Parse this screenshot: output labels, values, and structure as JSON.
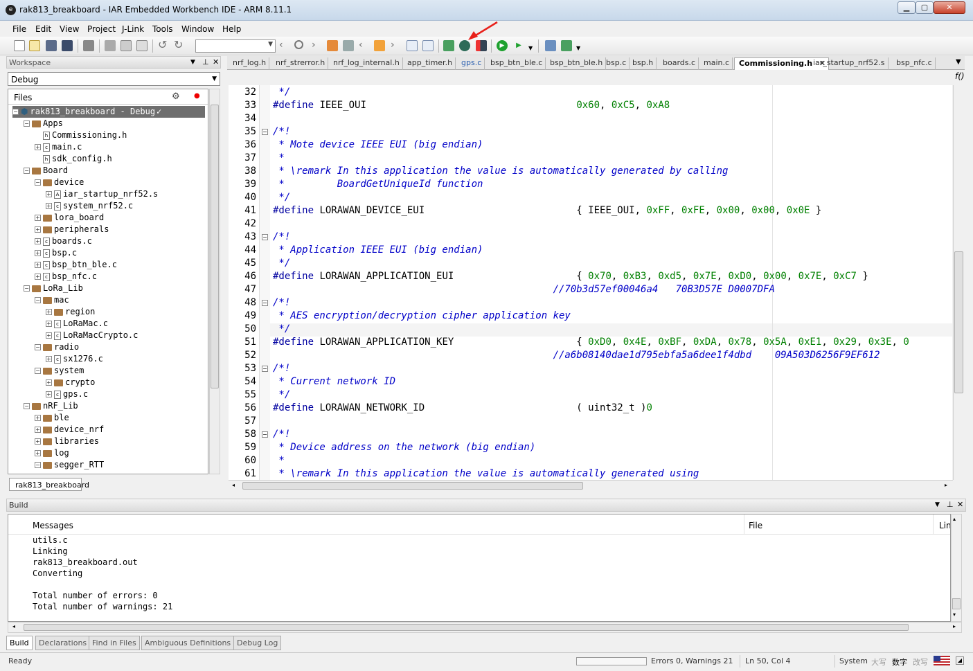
{
  "window": {
    "title": "rak813_breakboard - IAR Embedded Workbench IDE - ARM 8.11.1"
  },
  "menu": [
    "File",
    "Edit",
    "View",
    "Project",
    "J-Link",
    "Tools",
    "Window",
    "Help"
  ],
  "toolbar": {
    "combo_value": ""
  },
  "workspace": {
    "title": "Workspace",
    "config": "Debug",
    "files_label": "Files",
    "bottom_tab": "rak813_breakboard",
    "tree": [
      {
        "depth": 0,
        "type": "project",
        "label": "rak813_breakboard - Debug",
        "exp": "-"
      },
      {
        "depth": 1,
        "type": "folder",
        "label": "Apps",
        "exp": "-"
      },
      {
        "depth": 2,
        "type": "h",
        "label": "Commissioning.h",
        "exp": ""
      },
      {
        "depth": 2,
        "type": "c",
        "label": "main.c",
        "exp": "+"
      },
      {
        "depth": 2,
        "type": "h",
        "label": "sdk_config.h",
        "exp": ""
      },
      {
        "depth": 1,
        "type": "folder",
        "label": "Board",
        "exp": "-"
      },
      {
        "depth": 2,
        "type": "folder",
        "label": "device",
        "exp": "-"
      },
      {
        "depth": 3,
        "type": "asm",
        "label": "iar_startup_nrf52.s",
        "exp": "+"
      },
      {
        "depth": 3,
        "type": "c",
        "label": "system_nrf52.c",
        "exp": "+"
      },
      {
        "depth": 2,
        "type": "folder",
        "label": "lora_board",
        "exp": "+"
      },
      {
        "depth": 2,
        "type": "folder",
        "label": "peripherals",
        "exp": "+"
      },
      {
        "depth": 2,
        "type": "c",
        "label": "boards.c",
        "exp": "+"
      },
      {
        "depth": 2,
        "type": "c",
        "label": "bsp.c",
        "exp": "+"
      },
      {
        "depth": 2,
        "type": "c",
        "label": "bsp_btn_ble.c",
        "exp": "+"
      },
      {
        "depth": 2,
        "type": "c",
        "label": "bsp_nfc.c",
        "exp": "+"
      },
      {
        "depth": 1,
        "type": "folder",
        "label": "LoRa_Lib",
        "exp": "-"
      },
      {
        "depth": 2,
        "type": "folder",
        "label": "mac",
        "exp": "-"
      },
      {
        "depth": 3,
        "type": "folder",
        "label": "region",
        "exp": "+"
      },
      {
        "depth": 3,
        "type": "c",
        "label": "LoRaMac.c",
        "exp": "+"
      },
      {
        "depth": 3,
        "type": "c",
        "label": "LoRaMacCrypto.c",
        "exp": "+"
      },
      {
        "depth": 2,
        "type": "folder",
        "label": "radio",
        "exp": "-"
      },
      {
        "depth": 3,
        "type": "c",
        "label": "sx1276.c",
        "exp": "+"
      },
      {
        "depth": 2,
        "type": "folder",
        "label": "system",
        "exp": "-"
      },
      {
        "depth": 3,
        "type": "folder",
        "label": "crypto",
        "exp": "+"
      },
      {
        "depth": 3,
        "type": "c",
        "label": "gps.c",
        "exp": "+"
      },
      {
        "depth": 1,
        "type": "folder",
        "label": "nRF_Lib",
        "exp": "-"
      },
      {
        "depth": 2,
        "type": "folder",
        "label": "ble",
        "exp": "+"
      },
      {
        "depth": 2,
        "type": "folder",
        "label": "device_nrf",
        "exp": "+"
      },
      {
        "depth": 2,
        "type": "folder",
        "label": "libraries",
        "exp": "+"
      },
      {
        "depth": 2,
        "type": "folder",
        "label": "log",
        "exp": "+"
      },
      {
        "depth": 2,
        "type": "folder",
        "label": "segger_RTT",
        "exp": "-"
      }
    ]
  },
  "editor": {
    "tabs": [
      "nrf_log.h",
      "nrf_strerror.h",
      "nrf_log_internal.h",
      "app_timer.h",
      "gps.c",
      "bsp_btn_ble.c",
      "bsp_btn_ble.h",
      "bsp.c",
      "bsp.h",
      "boards.c",
      "main.c",
      "Commissioning.h",
      "iar_startup_nrf52.s",
      "bsp_nfc.c"
    ],
    "active_tab": "Commissioning.h",
    "close_glyph": "✕",
    "func_glyph": "f()",
    "lines": [
      {
        "n": "32",
        "fold": "",
        "parts": [
          {
            "c": "cm",
            "t": " */"
          }
        ]
      },
      {
        "n": "33",
        "fold": "",
        "parts": [
          {
            "c": "kw",
            "t": "#define"
          },
          {
            "c": "",
            "t": " IEEE_OUI                                    "
          },
          {
            "c": "num",
            "t": "0x60"
          },
          {
            "c": "",
            "t": ", "
          },
          {
            "c": "num",
            "t": "0xC5"
          },
          {
            "c": "",
            "t": ", "
          },
          {
            "c": "num",
            "t": "0xA8"
          }
        ]
      },
      {
        "n": "34",
        "fold": "",
        "parts": []
      },
      {
        "n": "35",
        "fold": "-",
        "parts": [
          {
            "c": "cm",
            "t": "/*!"
          }
        ]
      },
      {
        "n": "36",
        "fold": "",
        "parts": [
          {
            "c": "cm",
            "t": " * Mote device IEEE EUI (big endian)"
          }
        ]
      },
      {
        "n": "37",
        "fold": "",
        "parts": [
          {
            "c": "cm",
            "t": " *"
          }
        ]
      },
      {
        "n": "38",
        "fold": "",
        "parts": [
          {
            "c": "cm",
            "t": " * \\remark In this application the value is automatically generated by calling"
          }
        ]
      },
      {
        "n": "39",
        "fold": "",
        "parts": [
          {
            "c": "cm",
            "t": " *         BoardGetUniqueId function"
          }
        ]
      },
      {
        "n": "40",
        "fold": "",
        "parts": [
          {
            "c": "cm",
            "t": " */"
          }
        ]
      },
      {
        "n": "41",
        "fold": "",
        "parts": [
          {
            "c": "kw",
            "t": "#define"
          },
          {
            "c": "",
            "t": " LORAWAN_DEVICE_EUI                          { IEEE_OUI, "
          },
          {
            "c": "num",
            "t": "0xFF"
          },
          {
            "c": "",
            "t": ", "
          },
          {
            "c": "num",
            "t": "0xFE"
          },
          {
            "c": "",
            "t": ", "
          },
          {
            "c": "num",
            "t": "0x00"
          },
          {
            "c": "",
            "t": ", "
          },
          {
            "c": "num",
            "t": "0x00"
          },
          {
            "c": "",
            "t": ", "
          },
          {
            "c": "num",
            "t": "0x0E"
          },
          {
            "c": "",
            "t": " }"
          }
        ]
      },
      {
        "n": "42",
        "fold": "",
        "parts": []
      },
      {
        "n": "43",
        "fold": "-",
        "parts": [
          {
            "c": "cm",
            "t": "/*!"
          }
        ]
      },
      {
        "n": "44",
        "fold": "",
        "parts": [
          {
            "c": "cm",
            "t": " * Application IEEE EUI (big endian)"
          }
        ]
      },
      {
        "n": "45",
        "fold": "",
        "parts": [
          {
            "c": "cm",
            "t": " */"
          }
        ]
      },
      {
        "n": "46",
        "fold": "",
        "parts": [
          {
            "c": "kw",
            "t": "#define"
          },
          {
            "c": "",
            "t": " LORAWAN_APPLICATION_EUI                     { "
          },
          {
            "c": "num",
            "t": "0x70"
          },
          {
            "c": "",
            "t": ", "
          },
          {
            "c": "num",
            "t": "0xB3"
          },
          {
            "c": "",
            "t": ", "
          },
          {
            "c": "num",
            "t": "0xd5"
          },
          {
            "c": "",
            "t": ", "
          },
          {
            "c": "num",
            "t": "0x7E"
          },
          {
            "c": "",
            "t": ", "
          },
          {
            "c": "num",
            "t": "0xD0"
          },
          {
            "c": "",
            "t": ", "
          },
          {
            "c": "num",
            "t": "0x00"
          },
          {
            "c": "",
            "t": ", "
          },
          {
            "c": "num",
            "t": "0x7E"
          },
          {
            "c": "",
            "t": ", "
          },
          {
            "c": "num",
            "t": "0xC7"
          },
          {
            "c": "",
            "t": " }"
          }
        ]
      },
      {
        "n": "47",
        "fold": "",
        "parts": [
          {
            "c": "",
            "t": "                                                "
          },
          {
            "c": "cm",
            "t": "//70b3d57ef00046a4   70B3D57E D0007DFA"
          }
        ]
      },
      {
        "n": "48",
        "fold": "-",
        "parts": [
          {
            "c": "cm",
            "t": "/*!"
          }
        ]
      },
      {
        "n": "49",
        "fold": "",
        "parts": [
          {
            "c": "cm",
            "t": " * AES encryption/decryption cipher application key"
          }
        ]
      },
      {
        "n": "50",
        "fold": "",
        "parts": [
          {
            "c": "cm",
            "t": " */"
          }
        ]
      },
      {
        "n": "51",
        "fold": "",
        "parts": [
          {
            "c": "kw",
            "t": "#define"
          },
          {
            "c": "",
            "t": " LORAWAN_APPLICATION_KEY                     { "
          },
          {
            "c": "num",
            "t": "0xD0"
          },
          {
            "c": "",
            "t": ", "
          },
          {
            "c": "num",
            "t": "0x4E"
          },
          {
            "c": "",
            "t": ", "
          },
          {
            "c": "num",
            "t": "0xBF"
          },
          {
            "c": "",
            "t": ", "
          },
          {
            "c": "num",
            "t": "0xDA"
          },
          {
            "c": "",
            "t": ", "
          },
          {
            "c": "num",
            "t": "0x78"
          },
          {
            "c": "",
            "t": ", "
          },
          {
            "c": "num",
            "t": "0x5A"
          },
          {
            "c": "",
            "t": ", "
          },
          {
            "c": "num",
            "t": "0xE1"
          },
          {
            "c": "",
            "t": ", "
          },
          {
            "c": "num",
            "t": "0x29"
          },
          {
            "c": "",
            "t": ", "
          },
          {
            "c": "num",
            "t": "0x3E"
          },
          {
            "c": "",
            "t": ", "
          },
          {
            "c": "num",
            "t": "0"
          }
        ]
      },
      {
        "n": "52",
        "fold": "",
        "parts": [
          {
            "c": "",
            "t": "                                                "
          },
          {
            "c": "cm",
            "t": "//a6b08140dae1d795ebfa5a6dee1f4dbd    09A503D6256F9EF612"
          }
        ]
      },
      {
        "n": "53",
        "fold": "-",
        "parts": [
          {
            "c": "cm",
            "t": "/*!"
          }
        ]
      },
      {
        "n": "54",
        "fold": "",
        "parts": [
          {
            "c": "cm",
            "t": " * Current network ID"
          }
        ]
      },
      {
        "n": "55",
        "fold": "",
        "parts": [
          {
            "c": "cm",
            "t": " */"
          }
        ]
      },
      {
        "n": "56",
        "fold": "",
        "parts": [
          {
            "c": "kw",
            "t": "#define"
          },
          {
            "c": "",
            "t": " LORAWAN_NETWORK_ID                          ( uint32_t )"
          },
          {
            "c": "num",
            "t": "0"
          }
        ]
      },
      {
        "n": "57",
        "fold": "",
        "parts": []
      },
      {
        "n": "58",
        "fold": "-",
        "parts": [
          {
            "c": "cm",
            "t": "/*!"
          }
        ]
      },
      {
        "n": "59",
        "fold": "",
        "parts": [
          {
            "c": "cm",
            "t": " * Device address on the network (big endian)"
          }
        ]
      },
      {
        "n": "60",
        "fold": "",
        "parts": [
          {
            "c": "cm",
            "t": " *"
          }
        ]
      },
      {
        "n": "61",
        "fold": "",
        "parts": [
          {
            "c": "cm",
            "t": " * \\remark In this application the value is automatically generated using"
          }
        ]
      }
    ]
  },
  "build": {
    "title": "Build",
    "col_messages": "Messages",
    "col_file": "File",
    "col_line": "Lin",
    "messages": [
      "utils.c",
      "Linking",
      "rak813_breakboard.out",
      "Converting",
      "",
      "Total number of errors: 0",
      "Total number of warnings: 21"
    ],
    "tabs": [
      "Build",
      "Declarations",
      "Find in Files",
      "Ambiguous Definitions",
      "Debug Log"
    ],
    "active_tab": "Build"
  },
  "status": {
    "ready": "Ready",
    "progress": 0,
    "errors": "Errors 0, Warnings 21",
    "position": "Ln 50, Col 4",
    "system": "System",
    "ime1": "大写",
    "ime2": "数字",
    "ime3": "改写"
  },
  "colors": {
    "comment": "#0000c8",
    "number": "#008000",
    "keyword": "#0000a0",
    "arrow": "#e8201a"
  }
}
